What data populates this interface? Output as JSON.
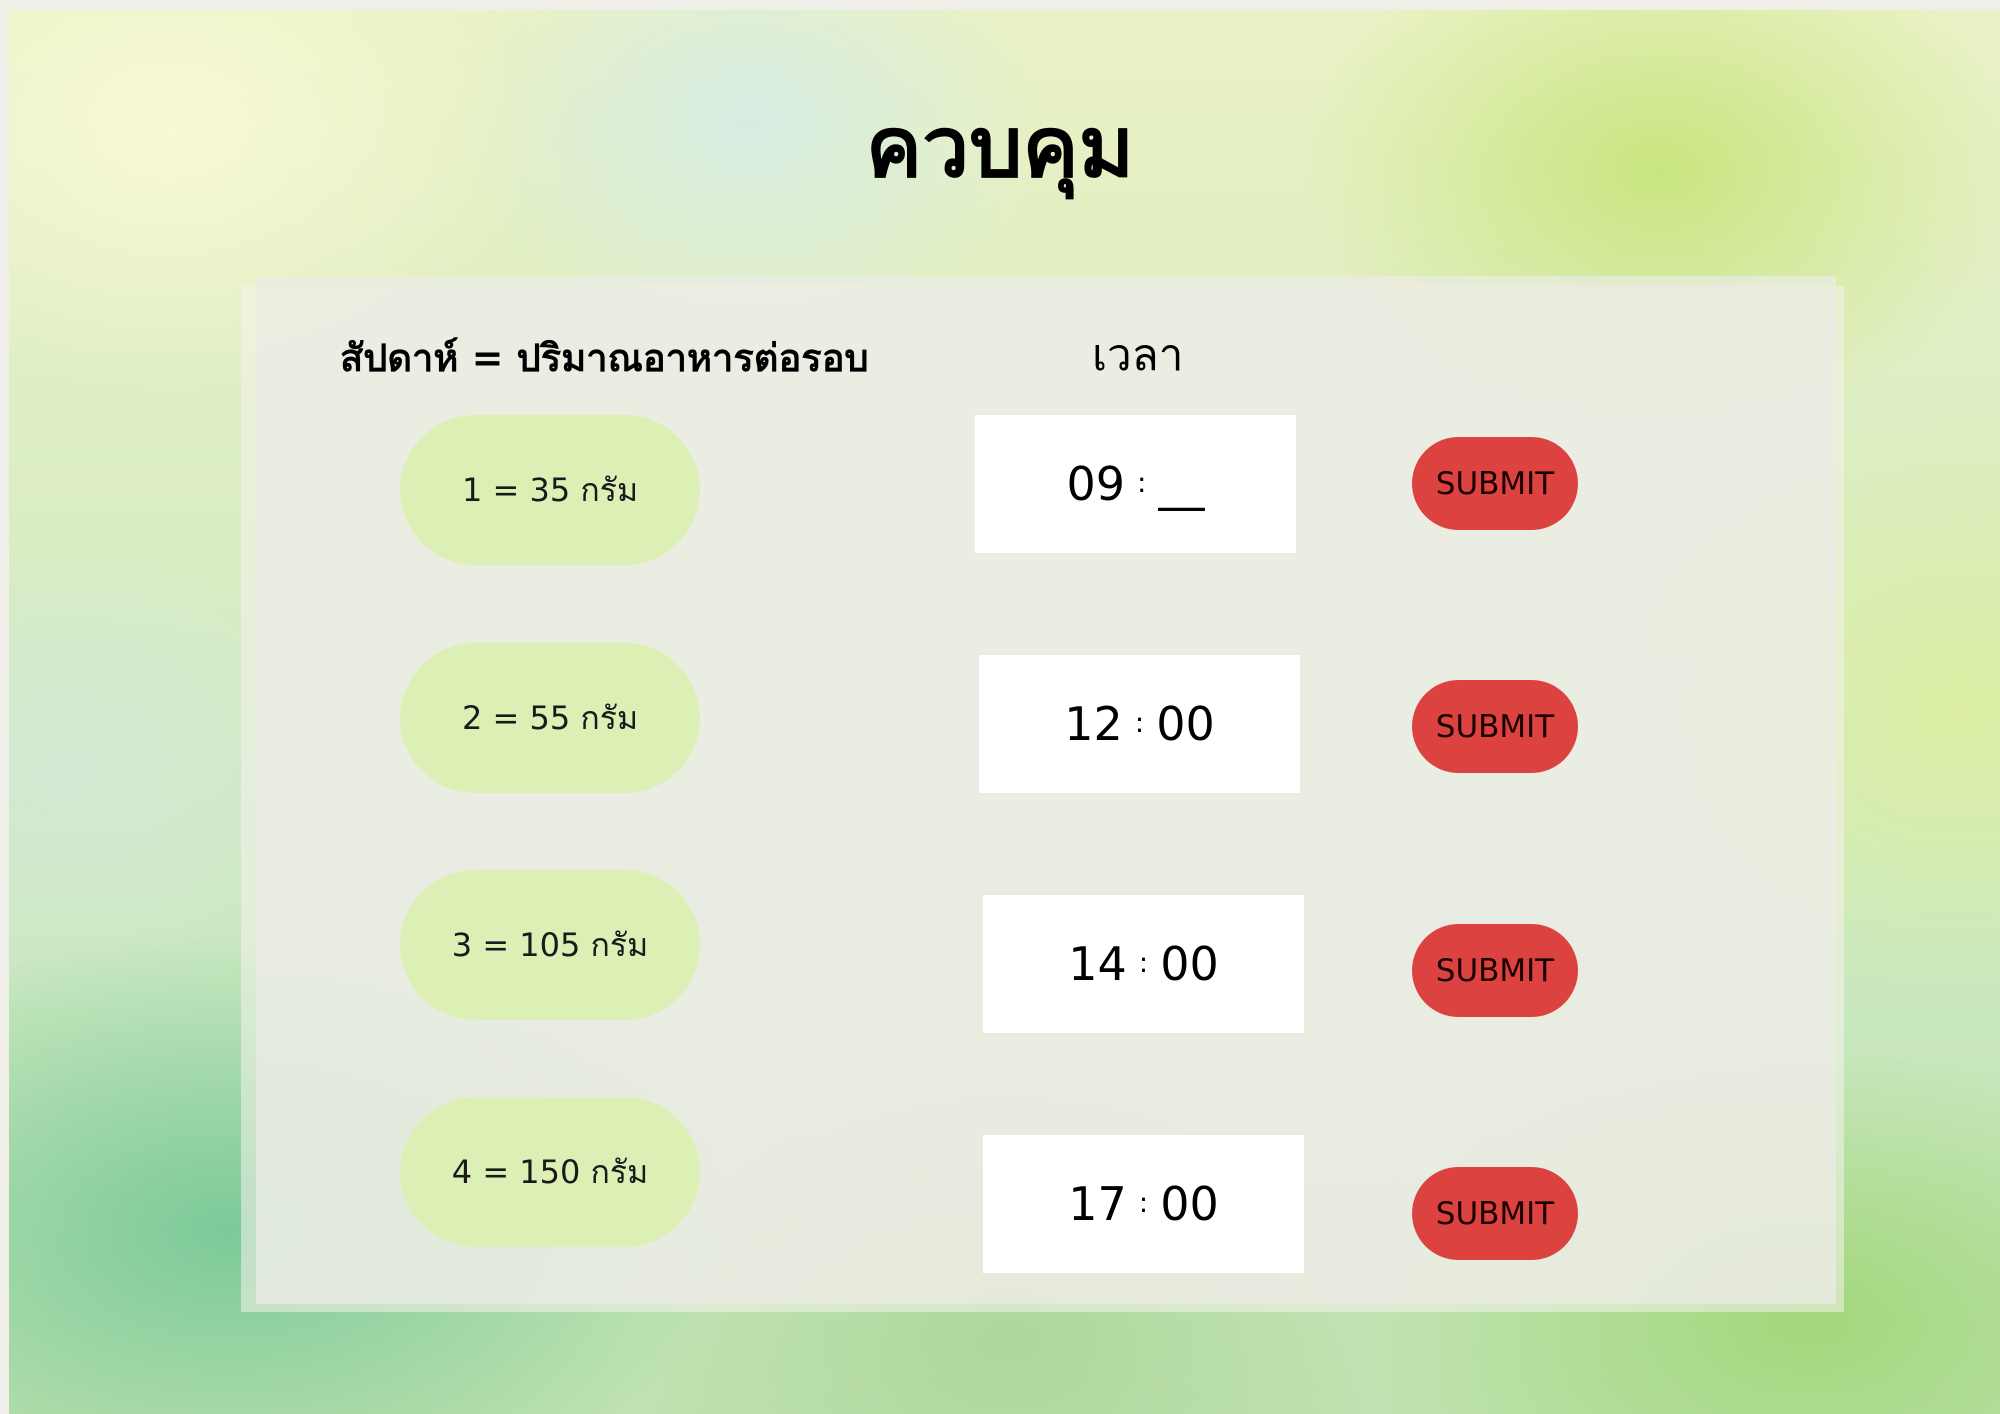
{
  "title": "ควบคุม",
  "headers": {
    "week_portion": "สัปดาห์ = ปริมาณอาหารต่อรอบ",
    "time": "เวลา"
  },
  "rows": [
    {
      "portion": "1 = 35 กรัม",
      "hour": "09",
      "separator": ":",
      "minute": "__",
      "submit_label": "SUBMIT"
    },
    {
      "portion": "2 = 55 กรัม",
      "hour": "12",
      "separator": ":",
      "minute": "00",
      "submit_label": "SUBMIT"
    },
    {
      "portion": "3 = 105 กรัม",
      "hour": "14",
      "separator": ":",
      "minute": "00",
      "submit_label": "SUBMIT"
    },
    {
      "portion": "4 = 150 กรัม",
      "hour": "17",
      "separator": ":",
      "minute": "00",
      "submit_label": "SUBMIT"
    }
  ],
  "colors": {
    "pill": "#dcf0b6",
    "submit": "#dc4240",
    "timebox": "#ffffff"
  }
}
